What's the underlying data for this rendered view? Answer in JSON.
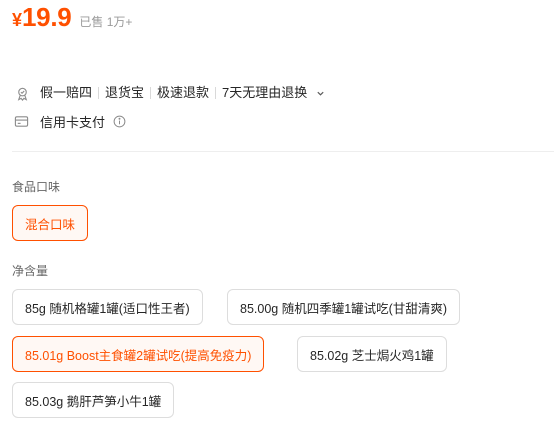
{
  "price": {
    "symbol": "¥",
    "value": "19.9",
    "sold": "已售 1万+"
  },
  "services": {
    "items": [
      "假一赔四",
      "退货宝",
      "极速退款",
      "7天无理由退换"
    ],
    "payment": "信用卡支付"
  },
  "flavor": {
    "label": "食品口味",
    "options": [
      "混合口味"
    ],
    "selected": 0
  },
  "net_weight": {
    "label": "净含量",
    "options": [
      "85g 随机格罐1罐(适口性王者)",
      "85.00g 随机四季罐1罐试吃(甘甜清爽)",
      "85.01g Boost主食罐2罐试吃(提高免疫力)",
      "85.02g 芝士焗火鸡1罐",
      "85.03g 鹅肝芦笋小牛1罐"
    ],
    "selected": 2
  },
  "colors": {
    "accent": "#ff5000"
  },
  "icons": {
    "guarantee": "shield-badge-icon",
    "payment": "credit-card-icon",
    "more": "chevron-down-icon",
    "info": "info-circle-icon"
  }
}
